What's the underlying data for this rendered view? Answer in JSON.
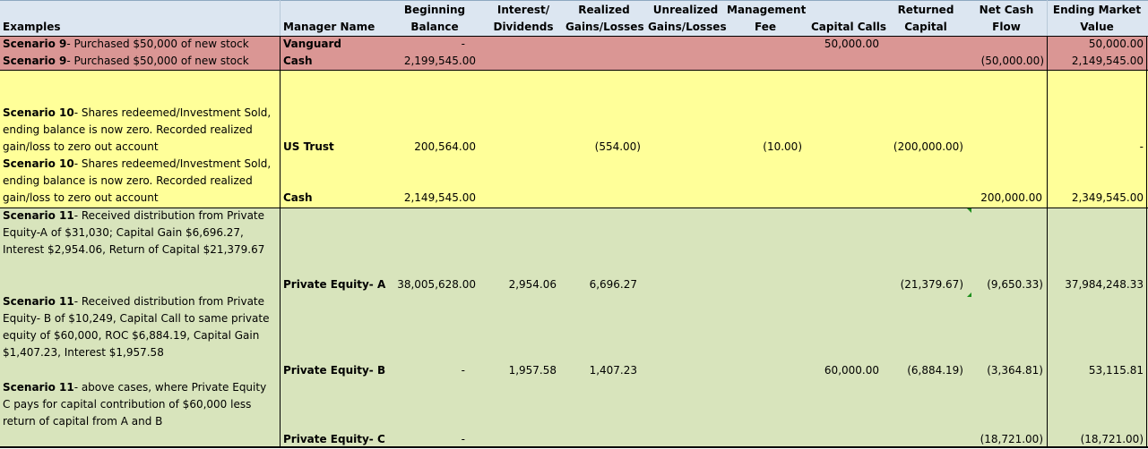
{
  "colors": {
    "header_bg": "#dce6f1",
    "scenario9_bg": "#da9694",
    "scenario10_bg": "#ffff99",
    "scenario11_bg": "#d8e4bc"
  },
  "headers": {
    "examples": "Examples",
    "manager": "Manager Name",
    "beginning": "Beginning Balance",
    "interest": "Interest/ Dividends",
    "realized": "Realized Gains/Losses",
    "unrealized": "Unrealized Gains/Losses",
    "mgmt": "Management Fee",
    "calls": "Capital Calls",
    "returned": "Returned Capital",
    "netcash": "Net Cash Flow",
    "ending": "Ending Market Value"
  },
  "s9": {
    "r1": {
      "label_b": "Scenario 9",
      "label": "- Purchased $50,000 of new stock",
      "manager": "Vanguard",
      "beginning": "-",
      "calls": "50,000.00",
      "ending": "50,000.00"
    },
    "r2": {
      "label_b": "Scenario 9",
      "label": "- Purchased $50,000 of new stock",
      "manager": "Cash",
      "beginning": "2,199,545.00",
      "netcash": "(50,000.00)",
      "ending": "2,149,545.00"
    }
  },
  "s10": {
    "text1_b": "Scenario 10",
    "text1": "- Shares redeemed/Investment Sold, ending balance is now zero. Recorded realized gain/loss to zero out account",
    "text2_b": "Scenario 10",
    "text2": "- Shares redeemed/Investment Sold, ending balance is now zero. Recorded realized gain/loss to zero out account",
    "r1": {
      "manager": "US Trust",
      "beginning": "200,564.00",
      "realized": "(554.00)",
      "mgmt": "(10.00)",
      "returned": "(200,000.00)",
      "ending": "-"
    },
    "r2": {
      "manager": "Cash",
      "beginning": "2,149,545.00",
      "netcash": "200,000.00",
      "ending": "2,349,545.00"
    }
  },
  "s11": {
    "text1_b": "Scenario 11",
    "text1": "-  Received distribution from Private Equity-A of $31,030; Capital Gain $6,696.27, Interest $2,954.06, Return of Capital $21,379.67",
    "text2_b": "Scenario 11",
    "text2": "-  Received distribution from Private Equity- B of $10,249, Capital Call to same private equity of $60,000, ROC $6,884.19, Capital Gain $1,407.23, Interest $1,957.58",
    "text3_b": "Scenario 11",
    "text3": "-  above cases, where Private Equity C pays for capital contribution of $60,000 less return of capital from A and B",
    "rA": {
      "manager": "Private Equity- A",
      "beginning": "38,005,628.00",
      "interest": "2,954.06",
      "realized": "6,696.27",
      "returned": "(21,379.67)",
      "netcash": "(9,650.33)",
      "ending": "37,984,248.33"
    },
    "rB": {
      "manager": "Private Equity- B",
      "beginning": "-",
      "interest": "1,957.58",
      "realized": "1,407.23",
      "calls": "60,000.00",
      "returned": "(6,884.19)",
      "netcash": "(3,364.81)",
      "ending": "53,115.81"
    },
    "rC": {
      "manager": "Private Equity- C",
      "beginning": "-",
      "netcash": "(18,721.00)",
      "ending": "(18,721.00)"
    }
  }
}
